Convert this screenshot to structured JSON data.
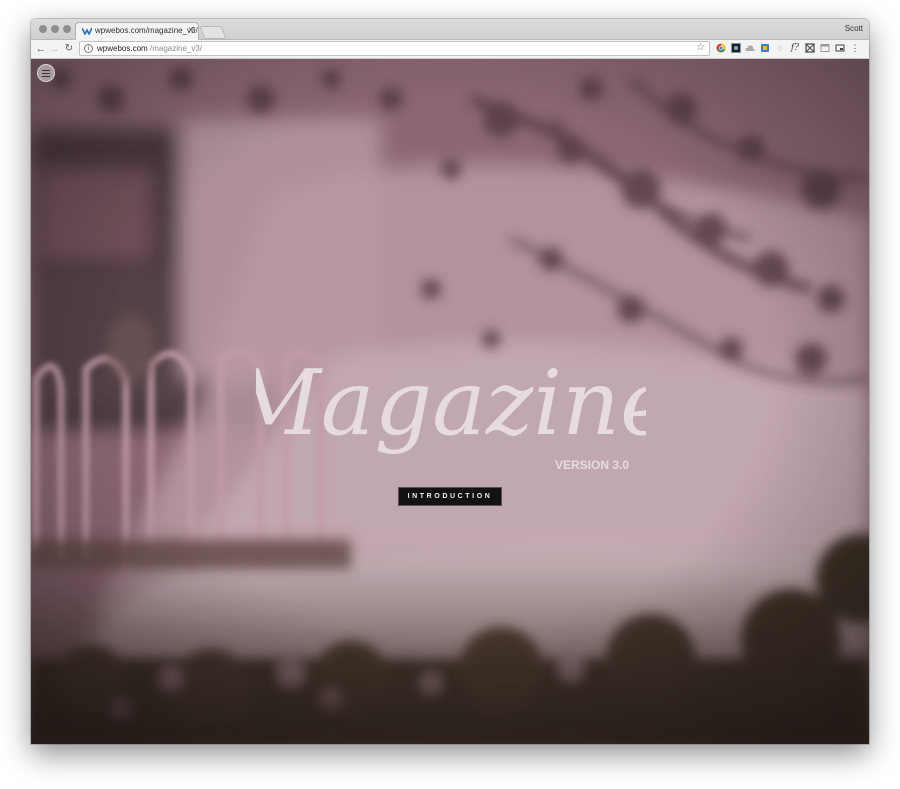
{
  "browser": {
    "tab": {
      "title": "wpwebos.com/magazine_v3/"
    },
    "profile_name": "Scott",
    "address_bar": {
      "domain": "wpwebos.com",
      "path": "/magazine_v3/"
    }
  },
  "hero": {
    "logo_text": "Magazine",
    "version_text": "VERSION 3.0",
    "intro_button_label": "INTRODUCTION",
    "colors": {
      "overlay": "#8c6a74",
      "logo": "#e6dcdf",
      "button_bg": "#141113"
    }
  }
}
